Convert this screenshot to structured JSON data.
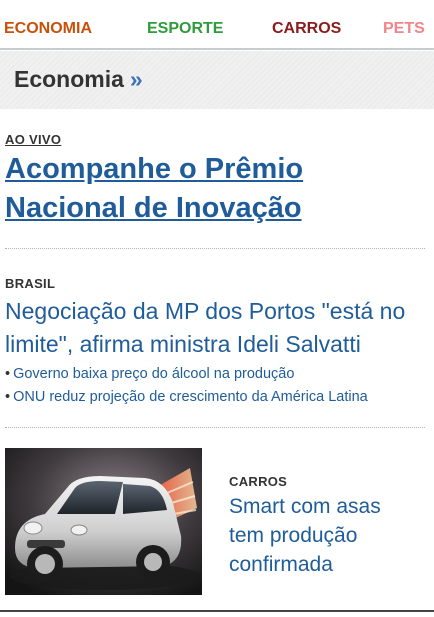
{
  "nav": {
    "tabs": [
      {
        "label": "ECONOMIA",
        "color": "#c8510a"
      },
      {
        "label": "ESPORTE",
        "color": "#2f9b3a"
      },
      {
        "label": "CARROS",
        "color": "#8a1c1c"
      },
      {
        "label": "PETS",
        "color": "#f0868a"
      }
    ]
  },
  "section": {
    "title": "Economia",
    "arrow": "»"
  },
  "lead": {
    "kicker": "AO VIVO",
    "headline": "Acompanhe o Prêmio Nacional de Inovação"
  },
  "story": {
    "kicker": "BRASIL",
    "headline": "Negociação da MP dos Portos \"está no limite\", afirma ministra Ideli Salvatti",
    "related": [
      "Governo baixa preço do álcool na produção",
      "ONU reduz projeção de crescimento da América Latina"
    ]
  },
  "card": {
    "image_icon": "car-photo",
    "kicker": "CARROS",
    "headline": "Smart com asas tem produção confirmada"
  },
  "colors": {
    "link": "#1f5c99",
    "text": "#333333"
  }
}
